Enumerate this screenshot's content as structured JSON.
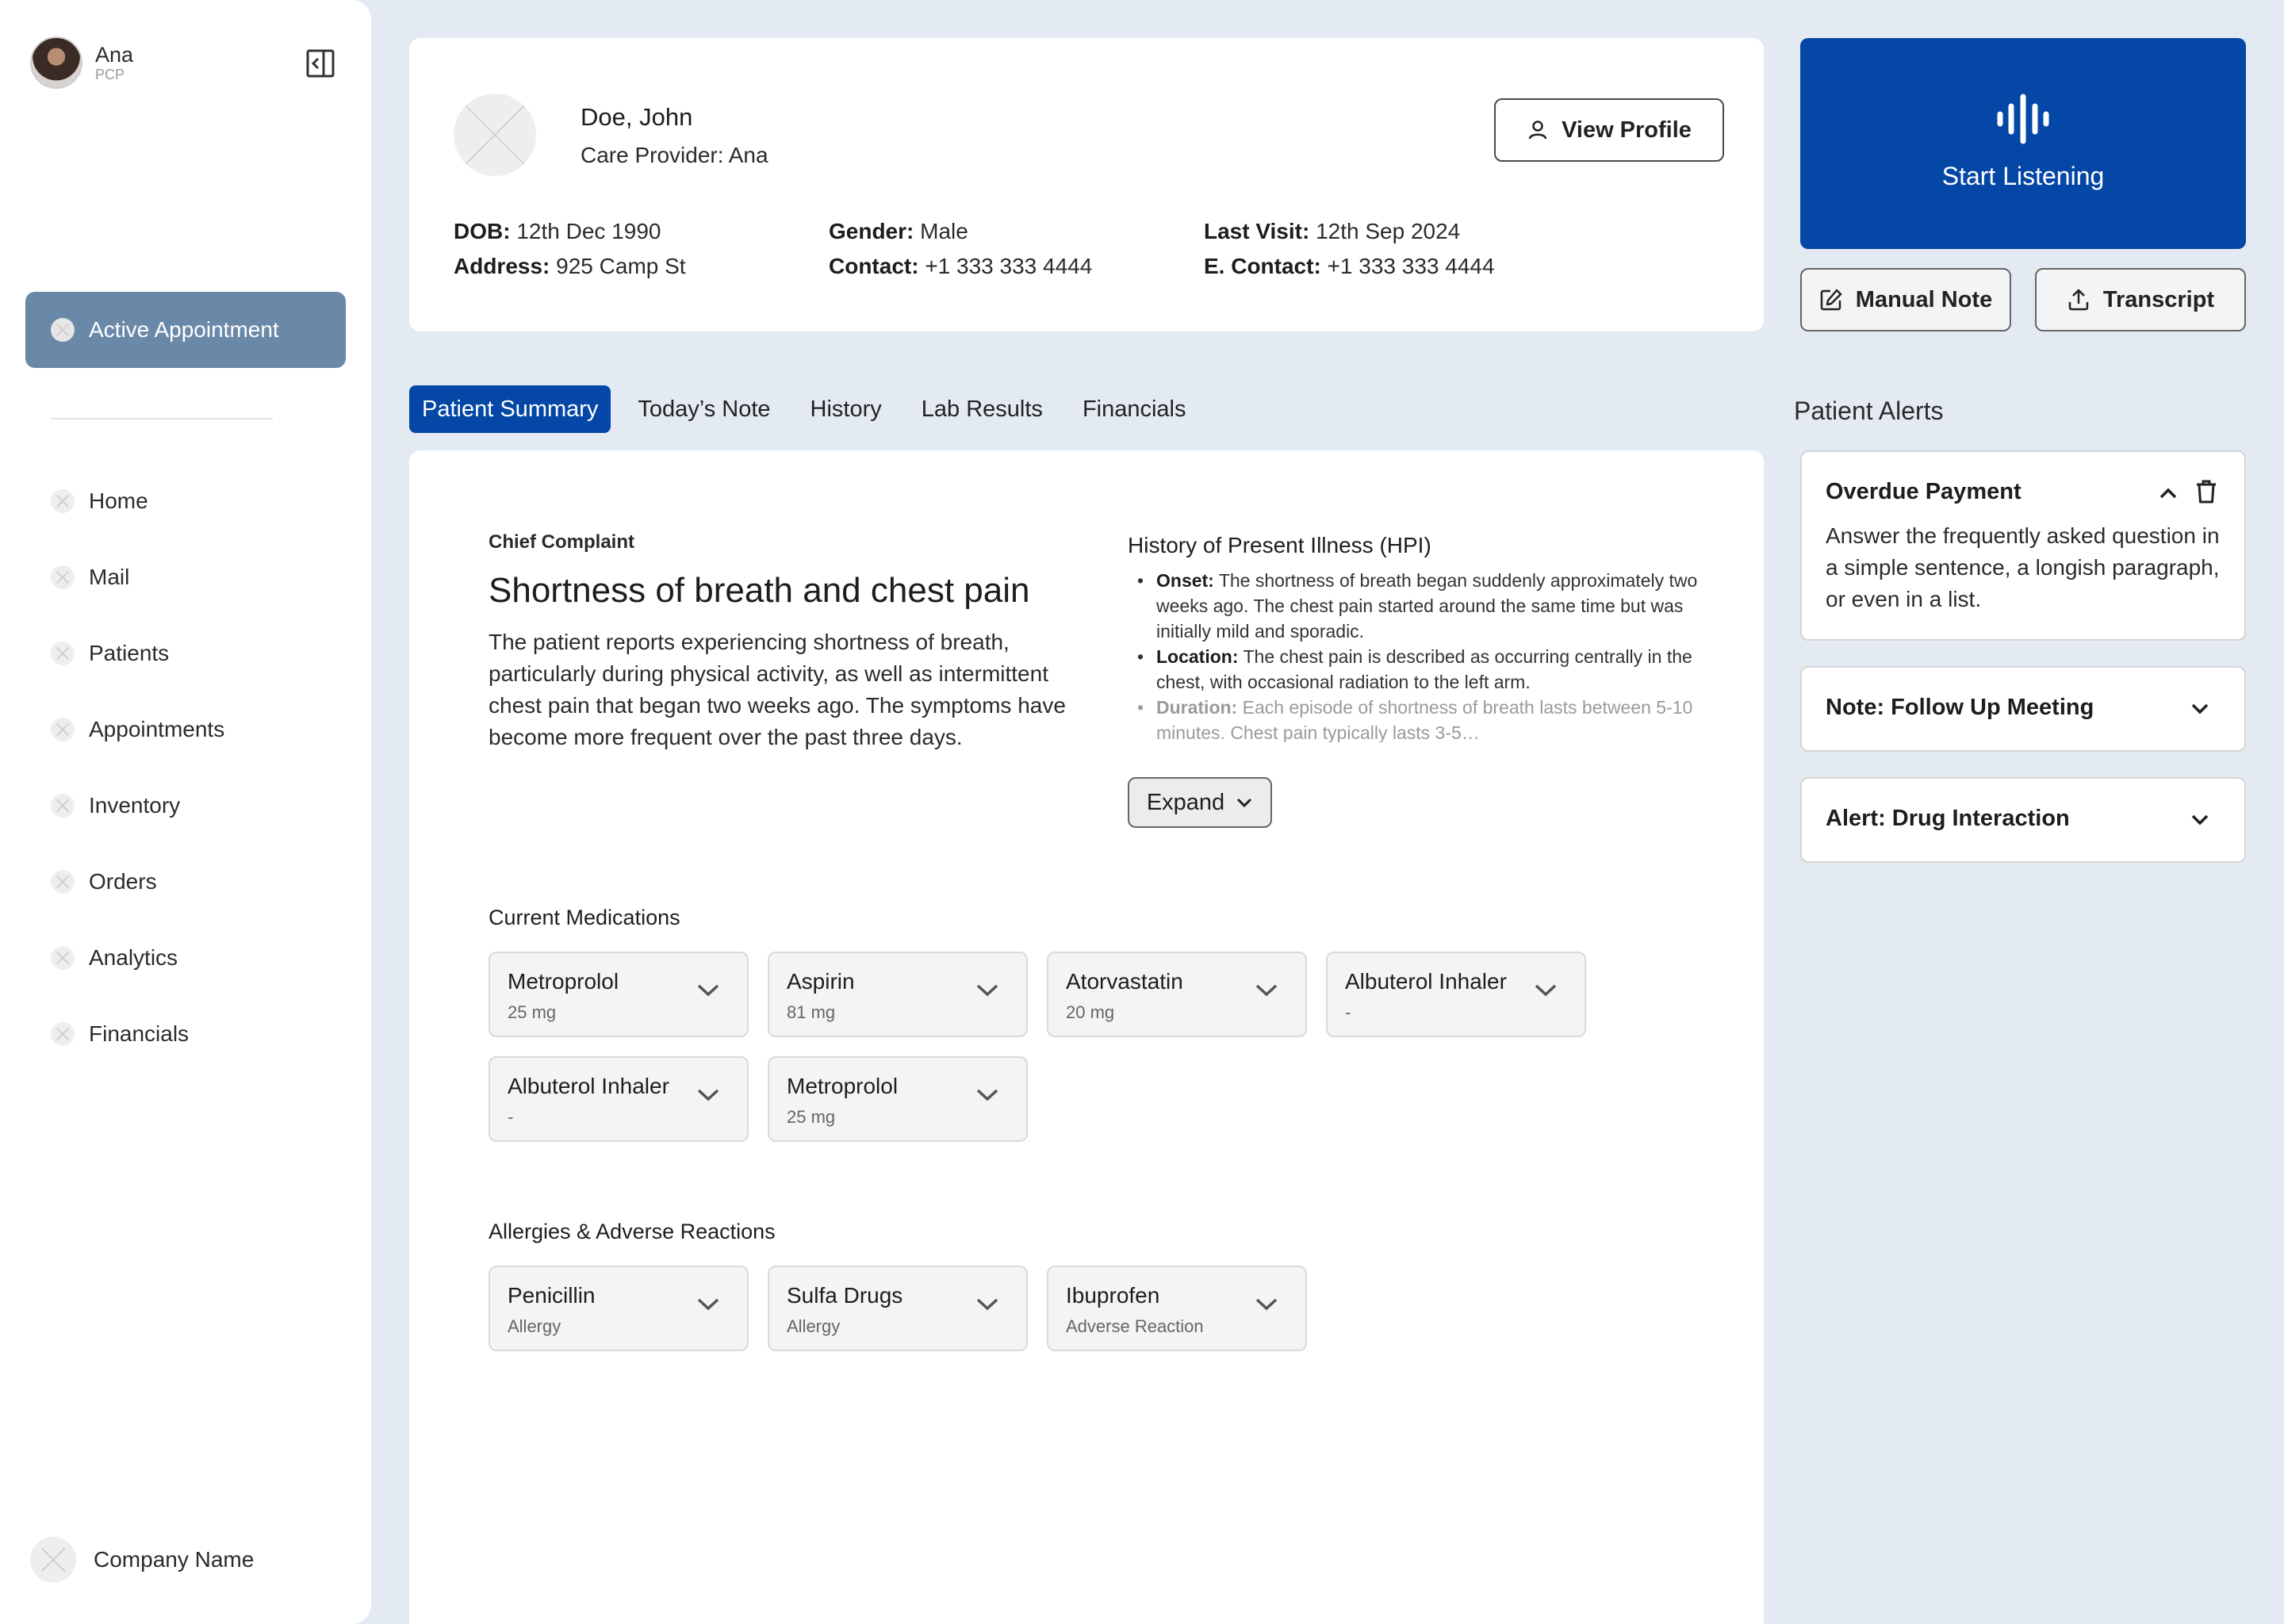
{
  "user": {
    "name": "Ana",
    "role": "PCP"
  },
  "sidebar": {
    "active_item": "Active Appointment",
    "items": [
      {
        "label": "Home"
      },
      {
        "label": "Mail"
      },
      {
        "label": "Patients"
      },
      {
        "label": "Appointments"
      },
      {
        "label": "Inventory"
      },
      {
        "label": "Orders"
      },
      {
        "label": "Analytics"
      },
      {
        "label": "Financials"
      }
    ],
    "company": "Company Name"
  },
  "patient": {
    "name": "Doe, John",
    "care_provider": "Care Provider: Ana",
    "view_profile_label": "View Profile",
    "dob_label": "DOB:",
    "dob": "12th Dec 1990",
    "gender_label": "Gender:",
    "gender": "Male",
    "last_visit_label": "Last Visit:",
    "last_visit": "12th Sep 2024",
    "address_label": "Address:",
    "address": "925 Camp St",
    "contact_label": "Contact:",
    "contact": "+1 333 333 4444",
    "e_contact_label": "E. Contact:",
    "e_contact": "+1 333 333 4444"
  },
  "actions": {
    "start_listening": "Start Listening",
    "manual_note": "Manual Note",
    "transcript": "Transcript"
  },
  "tabs": [
    {
      "label": "Patient Summary",
      "active": true
    },
    {
      "label": "Today’s Note"
    },
    {
      "label": "History"
    },
    {
      "label": "Lab Results"
    },
    {
      "label": "Financials"
    }
  ],
  "summary": {
    "chief_complaint_label": "Chief Complaint",
    "chief_complaint_title": "Shortness of breath and chest pain",
    "chief_complaint_body": "The patient reports experiencing shortness of breath, particularly during physical activity, as well as intermittent chest pain that began two weeks ago. The symptoms have become more frequent over the past three days.",
    "hpi_title": "History of Present Illness (HPI)",
    "hpi": [
      {
        "label": "Onset:",
        "text": " The shortness of breath began suddenly approximately two weeks ago. The chest pain started around the same time but was initially mild and sporadic."
      },
      {
        "label": "Location:",
        "text": " The chest pain is described as occurring centrally in the chest, with occasional radiation to the left arm."
      },
      {
        "label": "Duration:",
        "text": " Each episode of shortness of breath lasts between 5-10 minutes. Chest pain typically lasts 3-5…"
      }
    ],
    "expand_label": "Expand",
    "medications_label": "Current Medications",
    "medications": [
      {
        "name": "Metroprolol",
        "dose": "25 mg"
      },
      {
        "name": "Aspirin",
        "dose": "81 mg"
      },
      {
        "name": "Atorvastatin",
        "dose": "20 mg"
      },
      {
        "name": "Albuterol Inhaler",
        "dose": "-"
      },
      {
        "name": "Albuterol Inhaler",
        "dose": "-"
      },
      {
        "name": "Metroprolol",
        "dose": "25 mg"
      }
    ],
    "allergies_label": "Allergies & Adverse Reactions",
    "allergies": [
      {
        "name": "Penicillin",
        "type": "Allergy"
      },
      {
        "name": "Sulfa Drugs",
        "type": "Allergy"
      },
      {
        "name": "Ibuprofen",
        "type": "Adverse Reaction"
      }
    ]
  },
  "alerts": {
    "title": "Patient Alerts",
    "items": [
      {
        "title": "Overdue Payment",
        "body": "Answer the frequently asked question in a simple sentence, a longish paragraph, or even in a list."
      },
      {
        "title": "Note: Follow Up Meeting"
      },
      {
        "title": "Alert: Drug Interaction"
      }
    ]
  },
  "colors": {
    "primary": "#0447a6",
    "active_nav": "#6a88a8",
    "background": "#e3eaf2"
  }
}
